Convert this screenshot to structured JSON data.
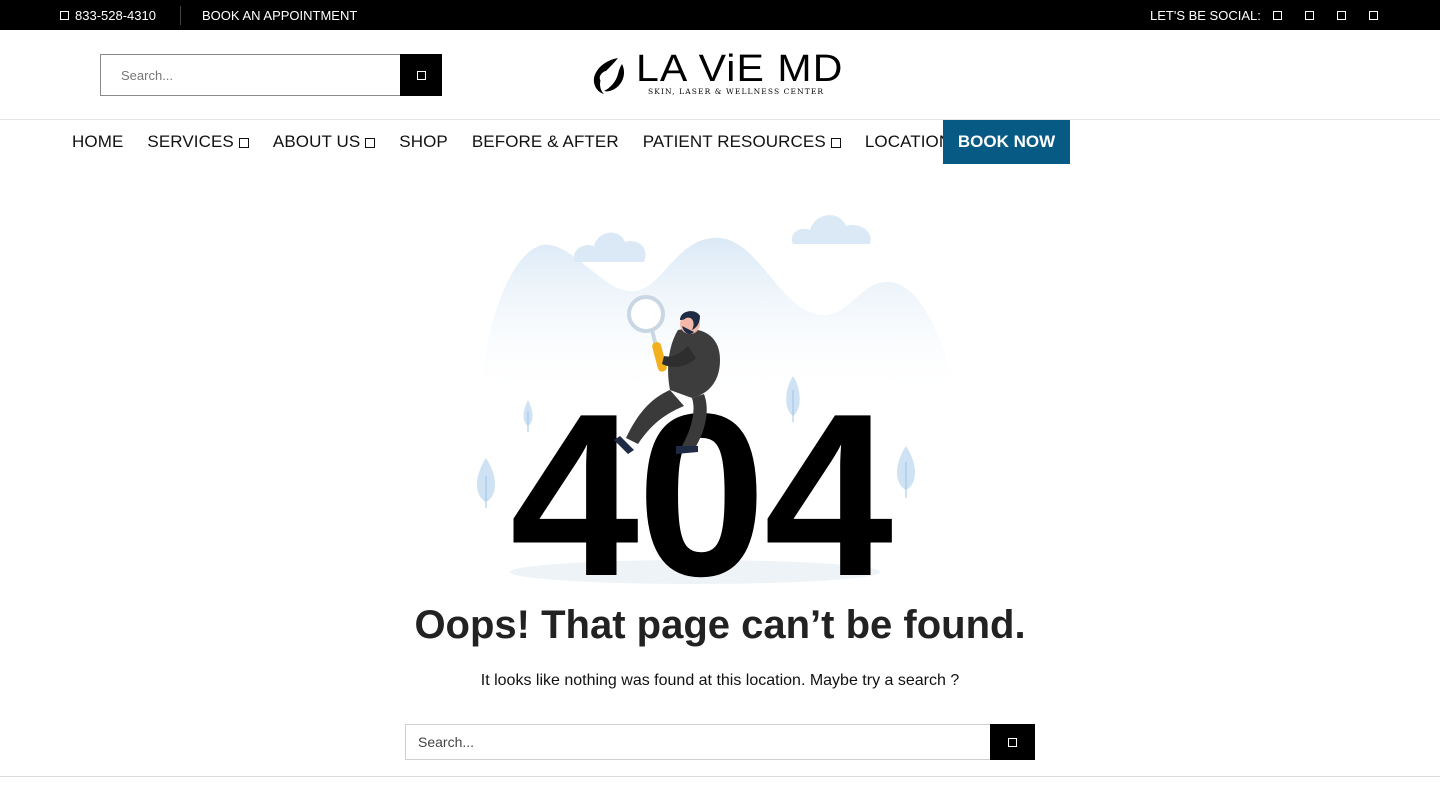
{
  "topbar": {
    "phone": "833-528-4310",
    "phone_icon": "phone-icon",
    "appointment_link": "BOOK AN APPOINTMENT",
    "social_label": "LET'S BE SOCIAL:",
    "social_icons": [
      "facebook-icon",
      "instagram-icon",
      "twitter-icon",
      "youtube-icon"
    ]
  },
  "header": {
    "search_placeholder": "Search...",
    "search_icon": "search-icon",
    "logo_text": "LA ViE MD",
    "logo_tagline": "SKIN, LASER & WELLNESS CENTER"
  },
  "nav": {
    "items": [
      {
        "label": "HOME",
        "has_dropdown": false
      },
      {
        "label": "SERVICES",
        "has_dropdown": true
      },
      {
        "label": "ABOUT US",
        "has_dropdown": true
      },
      {
        "label": "SHOP",
        "has_dropdown": false
      },
      {
        "label": "BEFORE & AFTER",
        "has_dropdown": false
      },
      {
        "label": "PATIENT RESOURCES",
        "has_dropdown": true
      },
      {
        "label": "LOCATIONS",
        "has_dropdown": true
      }
    ],
    "book_now": "BOOK NOW"
  },
  "error": {
    "code": "404",
    "headline": "Oops! That page can’t be found.",
    "message": "It looks like nothing was found at this location. Maybe try a search ?",
    "search_placeholder": "Search..."
  },
  "colors": {
    "topbar_bg": "#000000",
    "accent": "#075a84",
    "illustration_blue": "#dbe9f6"
  }
}
